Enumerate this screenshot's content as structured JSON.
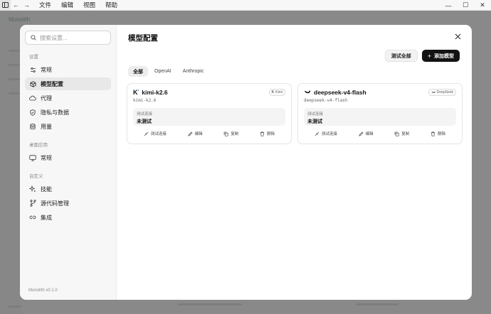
{
  "menubar": {
    "items": [
      "文件",
      "编辑",
      "视图",
      "帮助"
    ]
  },
  "background": {
    "app_name": "Monolith"
  },
  "search": {
    "placeholder": "搜索设置..."
  },
  "sidebar": {
    "sections": [
      {
        "label": "设置",
        "items": [
          {
            "label": "常规",
            "icon": "sliders-icon"
          },
          {
            "label": "模型配置",
            "icon": "cube-icon",
            "active": true
          },
          {
            "label": "代理",
            "icon": "cloud-icon"
          },
          {
            "label": "隐私与数据",
            "icon": "shield-icon"
          },
          {
            "label": "用量",
            "icon": "database-icon"
          }
        ]
      },
      {
        "label": "桌面应用",
        "items": [
          {
            "label": "常规",
            "icon": "monitor-icon"
          }
        ]
      },
      {
        "label": "自定义",
        "items": [
          {
            "label": "技能",
            "icon": "sparkle-icon"
          },
          {
            "label": "源代码管理",
            "icon": "git-branch-icon"
          },
          {
            "label": "集成",
            "icon": "link-icon"
          }
        ]
      }
    ],
    "version": "Monolith v0.1.0"
  },
  "main": {
    "title": "模型配置",
    "test_all_label": "测试全部",
    "add_model_label": "添加模型",
    "tabs": [
      {
        "label": "全部",
        "active": true
      },
      {
        "label": "OpenAI"
      },
      {
        "label": "Anthropic"
      }
    ],
    "cards": [
      {
        "name": "kimi-k2.6",
        "model_id": "kimi-k2.6",
        "provider": "Kimi",
        "provider_icon": "kimi-logo-icon",
        "status_label": "测试连接",
        "status_value": "未测试",
        "actions": [
          "测试连接",
          "编辑",
          "复制",
          "删除"
        ]
      },
      {
        "name": "deepseek-v4-flash",
        "model_id": "deepseek-v4-flash",
        "provider": "DeepSeek",
        "provider_icon": "deepseek-logo-icon",
        "status_label": "测试连接",
        "status_value": "未测试",
        "actions": [
          "测试连接",
          "编辑",
          "复制",
          "删除"
        ]
      }
    ]
  }
}
